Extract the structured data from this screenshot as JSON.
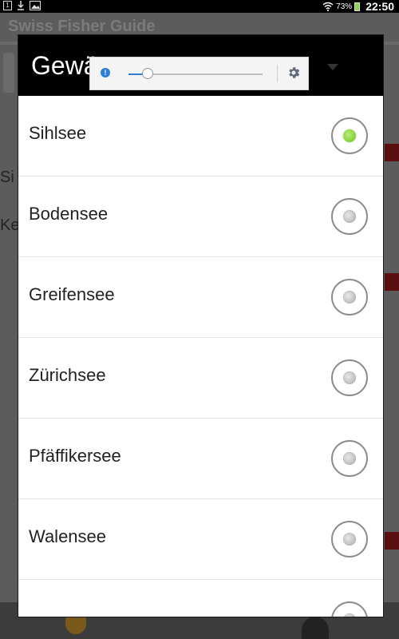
{
  "status_bar": {
    "left_icons": [
      "notification-count-icon",
      "download-icon",
      "image-icon"
    ],
    "notification_count": "1",
    "battery_percent": "73%",
    "time": "22:50"
  },
  "background_app": {
    "title": "Swiss Fisher Guide",
    "text_1": "Si",
    "text_2": "Ke"
  },
  "dialog": {
    "title": "Gewä",
    "selected_index": 0,
    "items": [
      {
        "label": "Sihlsee",
        "checked": true
      },
      {
        "label": "Bodensee",
        "checked": false
      },
      {
        "label": "Greifensee",
        "checked": false
      },
      {
        "label": "Zürichsee",
        "checked": false
      },
      {
        "label": "Pfäffikersee",
        "checked": false
      },
      {
        "label": "Walensee",
        "checked": false
      },
      {
        "label": "",
        "checked": false
      }
    ]
  },
  "brightness_popup": {
    "level_fraction": 0.14,
    "icons": [
      "alert-icon",
      "settings-gear-icon"
    ],
    "accent_color": "#2b7fd6"
  },
  "colors": {
    "radio_checked": "#6bc21c",
    "dialog_header": "#000000"
  }
}
